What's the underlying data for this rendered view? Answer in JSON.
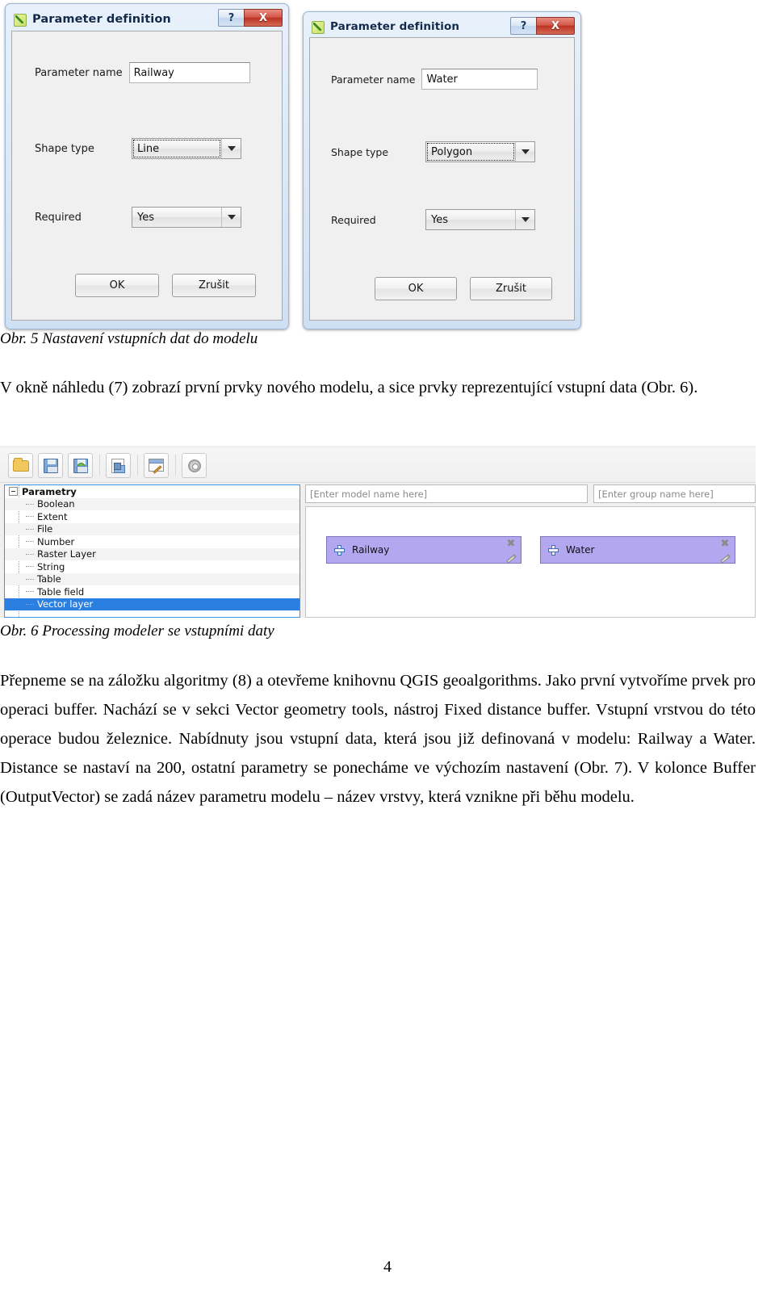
{
  "figure5": {
    "dialog1": {
      "title": "Parameter definition",
      "icon": "qgis-model-icon",
      "help_label": "?",
      "close_label": "X",
      "fields": {
        "name_label": "Parameter name",
        "name_value": "Railway",
        "shape_label": "Shape type",
        "shape_value": "Line",
        "required_label": "Required",
        "required_value": "Yes"
      },
      "ok_label": "OK",
      "cancel_label": "Zrušit"
    },
    "dialog2": {
      "title": "Parameter definition",
      "icon": "qgis-model-icon",
      "help_label": "?",
      "close_label": "X",
      "fields": {
        "name_label": "Parameter name",
        "name_value": "Water",
        "shape_label": "Shape type",
        "shape_value": "Polygon",
        "required_label": "Required",
        "required_value": "Yes"
      },
      "ok_label": "OK",
      "cancel_label": "Zrušit"
    },
    "caption": "Obr. 5 Nastavení vstupních dat do modelu"
  },
  "paragraph1": "V okně náhledu (7) zobrazí první prvky nového modelu, a sice prvky reprezentující vstupní data (Obr. 6).",
  "figure6": {
    "toolbar": [
      {
        "name": "open-model-button",
        "icon": "folder-icon"
      },
      {
        "name": "save-model-button",
        "icon": "floppy-disk-icon"
      },
      {
        "name": "save-model-as-button",
        "icon": "floppy-disk-check-icon"
      },
      {
        "name": "export-image-button",
        "icon": "export-image-icon"
      },
      {
        "name": "edit-help-button",
        "icon": "edit-document-icon"
      },
      {
        "name": "run-model-button",
        "icon": "gears-icon"
      }
    ],
    "tree": {
      "root": "Parametry",
      "items": [
        "Boolean",
        "Extent",
        "File",
        "Number",
        "Raster Layer",
        "String",
        "Table",
        "Table field",
        "Vector layer"
      ],
      "selected": "Vector layer"
    },
    "model_name_placeholder": "[Enter model name here]",
    "group_name_placeholder": "[Enter group name here]",
    "nodes": [
      {
        "label": "Railway",
        "close": "✖",
        "edit": "pencil-icon"
      },
      {
        "label": "Water",
        "close": "✖",
        "edit": "pencil-icon"
      }
    ],
    "caption": "Obr. 6 Processing modeler se vstupními daty"
  },
  "paragraph2": "Přepneme se na záložku algoritmy (8) a otevřeme knihovnu QGIS geoalgorithms. Jako první vytvoříme prvek pro operaci buffer. Nachází se v sekci Vector geometry tools, nástroj Fixed distance buffer. Vstupní vrstvou do této operace budou železnice. Nabídnuty jsou vstupní data, která jsou již definovaná v modelu: Railway a Water. Distance se nastaví na 200, ostatní parametry se ponecháme ve výchozím nastavení (Obr. 7). V kolonce Buffer (OutputVector) se zadá název parametru modelu – název vrstvy, která vznikne při běhu modelu.",
  "page_number": "4"
}
